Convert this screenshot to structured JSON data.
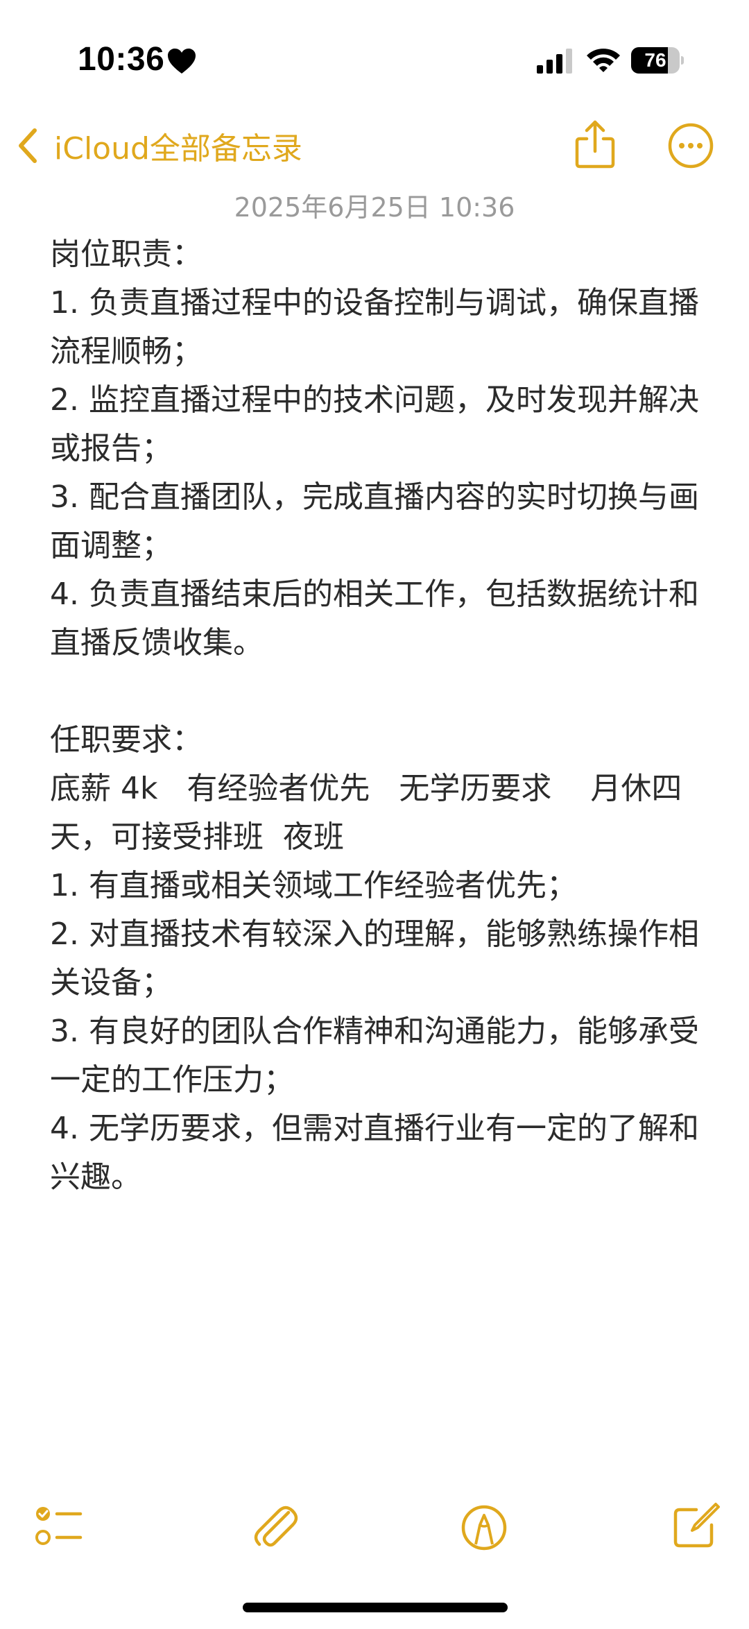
{
  "status_bar": {
    "time": "10:36",
    "battery_level": "76",
    "battery_percent": 76
  },
  "nav": {
    "back_label": "iCloud全部备忘录"
  },
  "note": {
    "date": "2025年6月25日 10:36",
    "lines": [
      "岗位职责：",
      "1. 负责直播过程中的设备控制与调试，确保直播流程顺畅；",
      "2. 监控直播过程中的技术问题，及时发现并解决或报告；",
      "3. 配合直播团队，完成直播内容的实时切换与画面调整；",
      "4. 负责直播结束后的相关工作，包括数据统计和直播反馈收集。",
      "",
      "任职要求：",
      "底薪 4k   有经验者优先   无学历要求    月休四天，可接受排班  夜班",
      "1. 有直播或相关领域工作经验者优先；",
      "2. 对直播技术有较深入的理解，能够熟练操作相关设备；",
      "3. 有良好的团队合作精神和沟通能力，能够承受一定的工作压力；",
      "4. 无学历要求，但需对直播行业有一定的了解和兴趣。"
    ]
  },
  "colors": {
    "accent": "#e0a81d",
    "text": "#2b2b2b",
    "date": "#9a9a9a"
  },
  "icons": {
    "back": "chevron-left-icon",
    "share": "share-icon",
    "more": "ellipsis-circle-icon",
    "checklist": "checklist-icon",
    "attach": "paperclip-icon",
    "markup": "pen-tip-circle-icon",
    "compose": "compose-icon"
  }
}
